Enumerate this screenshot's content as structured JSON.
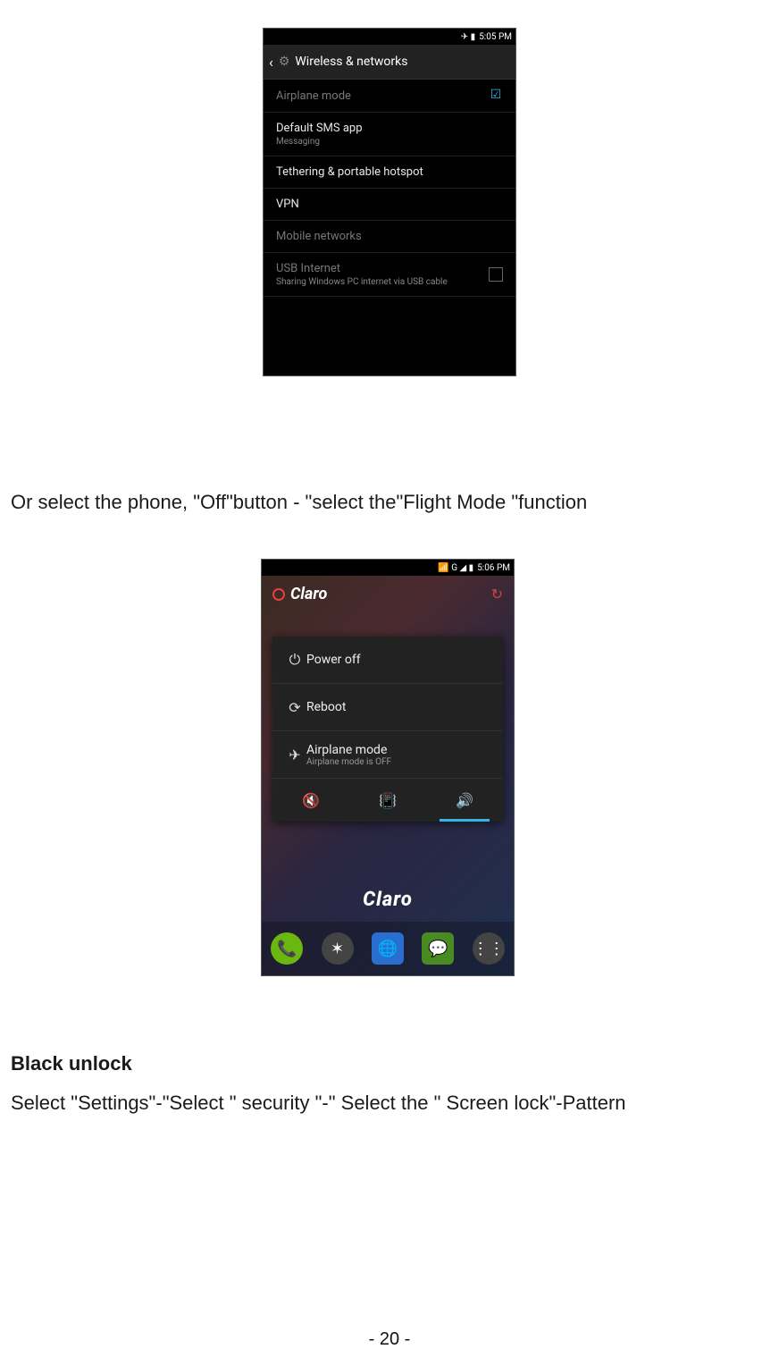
{
  "page_number": "- 20 -",
  "para1": "Or select the phone, \"Off\"button - \"select the\"Flight Mode \"function",
  "heading": "Black unlock",
  "para2": "Select \"Settings\"-\"Select \" security \"-\" Select the \" Screen lock\"-Pattern",
  "phone1": {
    "status": {
      "icons": "✈ ▮",
      "time": "5:05 PM"
    },
    "title": "Wireless & networks",
    "items": [
      {
        "primary": "Airplane mode",
        "checked": true
      },
      {
        "primary": "Default SMS app",
        "secondary": "Messaging"
      },
      {
        "primary": "Tethering & portable hotspot"
      },
      {
        "primary": "VPN"
      },
      {
        "primary": "Mobile networks",
        "disabled": true
      },
      {
        "primary": "USB Internet",
        "secondary": "Sharing Windows PC internet via USB cable",
        "disabled": true,
        "checkbox_off": true
      }
    ]
  },
  "phone2": {
    "status": {
      "icons": "📶 G ◢ ▮",
      "time": "5:06 PM"
    },
    "carrier": "Claro",
    "menu": {
      "poweroff": "Power off",
      "reboot": "Reboot",
      "airplane": "Airplane mode",
      "airplane_sub": "Airplane mode is OFF"
    },
    "home_label": "Claro"
  }
}
